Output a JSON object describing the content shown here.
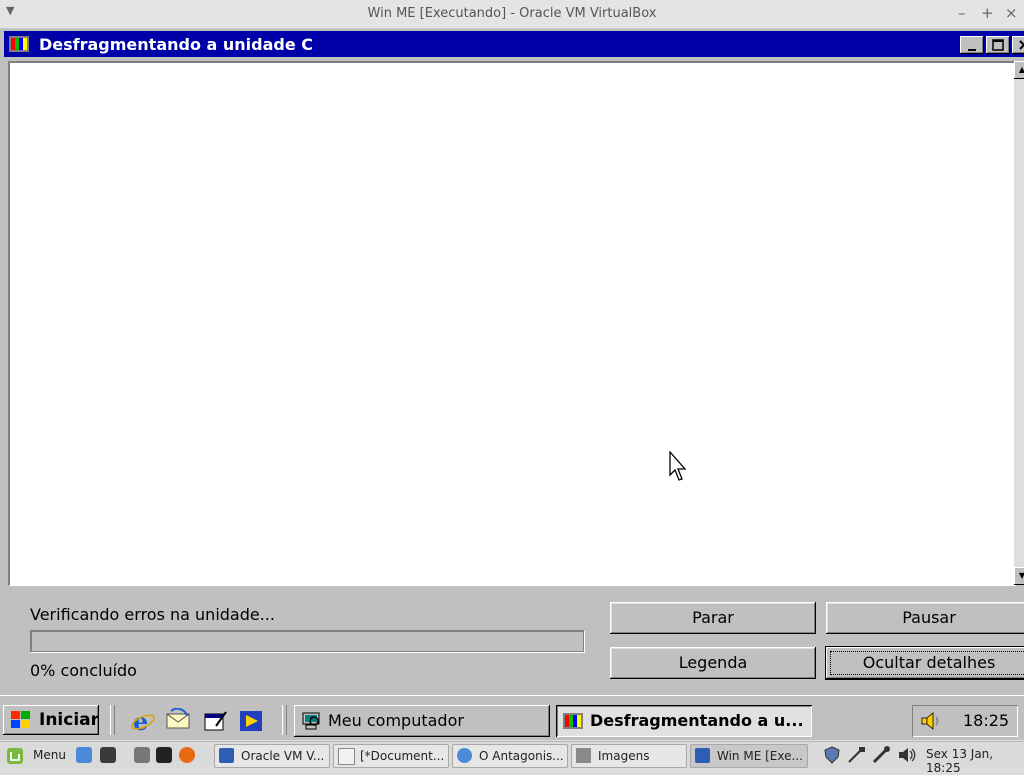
{
  "host_window": {
    "title": "Win ME [Executando] - Oracle VM VirtualBox",
    "controls": [
      "–",
      "+",
      "×"
    ]
  },
  "defrag": {
    "title": "Desfragmentando a unidade C",
    "status": "Verificando erros na unidade...",
    "progress_percent": 0,
    "percent_label": "0% concluído",
    "buttons": {
      "stop": "Parar",
      "pause": "Pausar",
      "legend": "Legenda",
      "hide_details": "Ocultar detalhes"
    }
  },
  "me_taskbar": {
    "start_label": "Iniciar",
    "quick_launch": [
      "internet-explorer-icon",
      "outlook-express-icon",
      "show-desktop-icon",
      "media-player-icon"
    ],
    "tasks": [
      {
        "label": "Meu computador",
        "icon": "my-computer-icon",
        "active": false
      },
      {
        "label": "Desfragmentando a u...",
        "icon": "defrag-icon",
        "active": true
      }
    ],
    "clock": "18:25"
  },
  "host_panel": {
    "menu_label": "Menu",
    "tasks": [
      {
        "label": "Oracle VM V...",
        "icon": "virtualbox-icon",
        "active": false
      },
      {
        "label": "[*Document...",
        "icon": "text-editor-icon",
        "active": false
      },
      {
        "label": "O Antagonis...",
        "icon": "chrome-icon",
        "active": false
      },
      {
        "label": "Imagens",
        "icon": "folder-icon",
        "active": false
      },
      {
        "label": "Win ME [Exe...",
        "icon": "virtualbox-icon",
        "active": true
      }
    ],
    "datetime": "Sex 13 Jan, 18:25"
  },
  "colors": {
    "win_titlebar": "#0000a8",
    "win_face": "#c0c0c0",
    "host_panel": "#dadada"
  }
}
